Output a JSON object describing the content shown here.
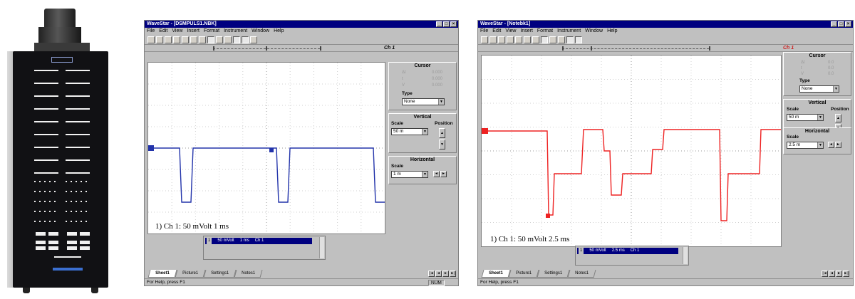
{
  "window1": {
    "title": "WaveStar - [DSMPULS1.NBK]",
    "menu": [
      "File",
      "Edit",
      "View",
      "Insert",
      "Format",
      "Instrument",
      "Window",
      "Help"
    ],
    "channel_tag": "Ch 1",
    "cursor": {
      "title": "Cursor",
      "readouts": [
        "Δt",
        "t",
        "V"
      ],
      "values": [
        "0.000",
        "0.000",
        "0.000"
      ]
    },
    "type": {
      "label": "Type",
      "value": "None"
    },
    "vertical": {
      "title": "Vertical",
      "scale_label": "Scale",
      "scale_value": "50 m",
      "position_label": "Position"
    },
    "horizontal": {
      "title": "Horizontal",
      "scale_label": "Scale",
      "scale_value": "1 m"
    },
    "scope_label": "1) Ch 1:   50 mVolt  1 ms",
    "channel_row": {
      "num": "1",
      "volt": "50 mVolt",
      "time": "1 ms",
      "name": "Ch 1"
    },
    "tabs": [
      "Sheet1",
      "Picture1",
      "Settings1",
      "Notes1"
    ],
    "status": "For Help, press F1",
    "status_num": "NUM",
    "colors": {
      "trace": "#2233aa"
    }
  },
  "window2": {
    "title": "WaveStar - [Notebk1]",
    "menu": [
      "File",
      "Edit",
      "View",
      "Insert",
      "Format",
      "Instrument",
      "Window",
      "Help"
    ],
    "channel_tag": "Ch 1",
    "cursor": {
      "title": "Cursor",
      "readouts": [
        "Δt",
        "t",
        "V"
      ],
      "values": [
        "0.0",
        "0.0",
        "0.0"
      ]
    },
    "type": {
      "label": "Type",
      "value": "None"
    },
    "vertical": {
      "title": "Vertical",
      "scale_label": "Scale",
      "scale_value": "50 m",
      "position_label": "Position"
    },
    "horizontal": {
      "title": "Horizontal",
      "scale_label": "Scale",
      "scale_value": "2.5 m"
    },
    "scope_label": "1) Ch 1:    50 mVolt  2.5 ms",
    "channel_row": {
      "num": "1",
      "volt": "50 mVolt",
      "time": "2.5 ms",
      "name": "Ch 1"
    },
    "tabs": [
      "Sheet1",
      "Picture1",
      "Settings1",
      "Notes1"
    ],
    "status": "For Help, press F1",
    "colors": {
      "trace": "#ee2222"
    }
  }
}
